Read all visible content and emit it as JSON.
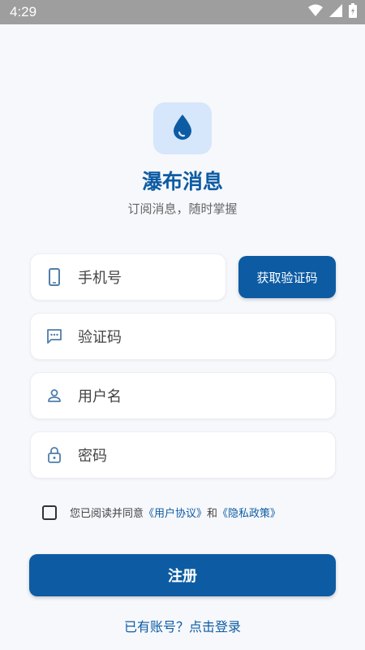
{
  "status_bar": {
    "time": "4:29"
  },
  "app": {
    "title": "瀑布消息",
    "subtitle": "订阅消息，随时掌握"
  },
  "form": {
    "phone_placeholder": "手机号",
    "get_code_label": "获取验证码",
    "code_placeholder": "验证码",
    "username_placeholder": "用户名",
    "password_placeholder": "密码"
  },
  "agreement": {
    "prefix": "您已阅读并同意",
    "user_agreement": "《用户协议》",
    "conjunction": "和",
    "privacy_policy": "《隐私政策》",
    "checked": false
  },
  "register_label": "注册",
  "login_link": "已有账号？点击登录",
  "colors": {
    "primary": "#0d5ca3",
    "icon_bg": "#d6e6fb",
    "status_bar": "#9e9e9e"
  },
  "icons": [
    "wifi-icon",
    "signal-icon",
    "battery-icon",
    "water-drop-icon",
    "phone-icon",
    "message-icon",
    "person-icon",
    "lock-icon"
  ]
}
